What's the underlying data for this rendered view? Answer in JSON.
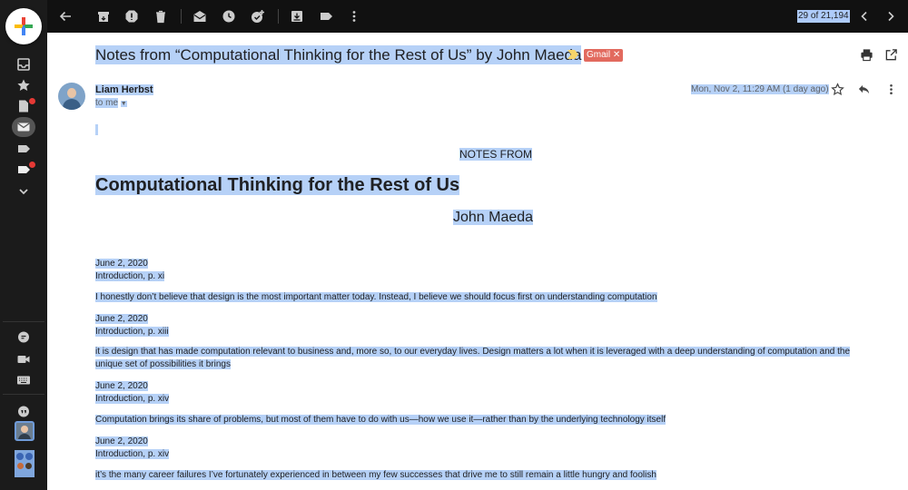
{
  "toolbar": {
    "counter": "29 of 21,194"
  },
  "message": {
    "subject": "Notes from “Computational Thinking for the Rest of Us” by John Maeda",
    "label_chip": "Gmail ✕",
    "sender_name": "Liam Herbst",
    "recipient": "to me",
    "date": "Mon, Nov 2, 11:29 AM (1 day ago)"
  },
  "body": {
    "notes_from": "NOTES FROM",
    "book_title": "Computational Thinking for the Rest of Us",
    "author": "John Maeda",
    "entries": [
      {
        "date": "June 2, 2020",
        "location": "Introduction, p. xi",
        "quote": "I honestly don’t believe that design is the most important matter today. Instead, I believe we should focus first on understanding computation"
      },
      {
        "date": "June 2, 2020",
        "location": "Introduction, p. xiii",
        "quote": "it is design that has made computation relevant to business and, more so, to our everyday lives. Design matters a lot when it is leveraged with a deep understanding of computation and the unique set of possibilities it brings"
      },
      {
        "date": "June 2, 2020",
        "location": "Introduction, p. xiv",
        "quote": "Computation brings its share of problems, but most of them have to do with us—how we use it—rather than by the underlying technology itself"
      },
      {
        "date": "June 2, 2020",
        "location": "Introduction, p. xiv",
        "quote": "it’s the many career failures I’ve fortunately experienced in between my few successes that drive me to still remain a little hungry and foolish"
      }
    ]
  },
  "icons": {
    "rail": [
      "compose-icon",
      "inbox-icon",
      "star-icon",
      "drafts-icon",
      "mail-icon",
      "label-icon",
      "label-icon",
      "expand-more-icon",
      "chat-icon",
      "video-icon",
      "keyboard-icon",
      "hangouts-icon"
    ],
    "toolbar": [
      "back-arrow-icon",
      "archive-icon",
      "report-spam-icon",
      "delete-icon",
      "mark-unread-icon",
      "snooze-icon",
      "add-task-icon",
      "move-to-icon",
      "label-icon",
      "more-vert-icon",
      "prev-chevron-icon",
      "next-chevron-icon"
    ],
    "message": [
      "print-icon",
      "open-new-window-icon",
      "star-outline-icon",
      "reply-icon",
      "more-vert-icon",
      "important-marker-icon"
    ]
  },
  "colors": {
    "selection": "#b6d1f7",
    "chip": "#e26a5e",
    "compose_accent": "#4285f4",
    "notification_dot": "#e53935"
  }
}
